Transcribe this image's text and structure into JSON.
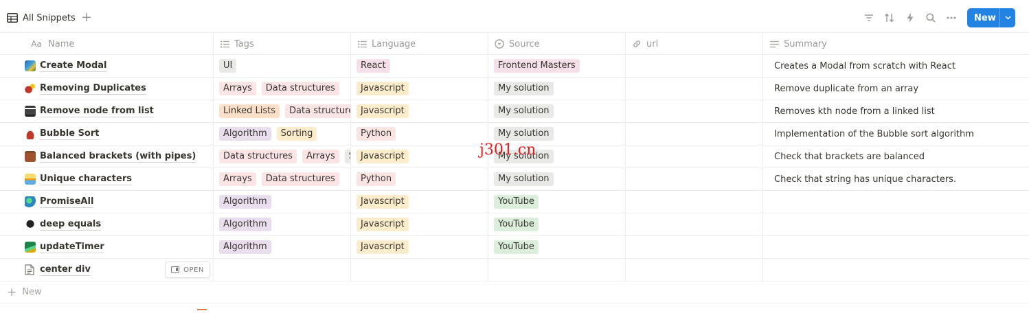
{
  "view": {
    "title": "All Snippets",
    "add_icon": "plus-icon"
  },
  "toolbar": {
    "icons": [
      "filter-icon",
      "sort-icon",
      "lightning-icon",
      "search-icon",
      "more-icon"
    ],
    "new_label": "New"
  },
  "columns": [
    {
      "label": "Name",
      "icon": "title-icon"
    },
    {
      "label": "Tags",
      "icon": "list-icon"
    },
    {
      "label": "Language",
      "icon": "list-icon"
    },
    {
      "label": "Source",
      "icon": "select-icon"
    },
    {
      "label": "url",
      "icon": "link-icon"
    },
    {
      "label": "Summary",
      "icon": "text-icon"
    }
  ],
  "colors": {
    "gray": "#e9e9e7",
    "red": "#fbe4e4",
    "orange": "#fbdfc9",
    "yellow": "#fbeccc",
    "purple": "#e8deee",
    "green": "#dbeddb",
    "pink": "#f5e0e9",
    "accent": "#2383e2"
  },
  "rows": [
    {
      "name": "Create Modal",
      "icon": "painting-icon",
      "tags": [
        {
          "t": "UI",
          "c": "gray"
        }
      ],
      "language": {
        "t": "React",
        "c": "pink"
      },
      "source": {
        "t": "Frontend Masters",
        "c": "pink"
      },
      "url": "",
      "summary": "Creates a Modal from scratch with React"
    },
    {
      "name": "Removing Duplicates",
      "icon": "party-popper-icon",
      "tags": [
        {
          "t": "Arrays",
          "c": "red"
        },
        {
          "t": "Data structures",
          "c": "red"
        }
      ],
      "language": {
        "t": "Javascript",
        "c": "yellow"
      },
      "source": {
        "t": "My solution",
        "c": "gray"
      },
      "url": "",
      "summary": "Remove duplicate from an array"
    },
    {
      "name": "Remove node from list",
      "icon": "bank-icon",
      "tags": [
        {
          "t": "Linked Lists",
          "c": "orange"
        },
        {
          "t": "Data structures",
          "c": "red"
        }
      ],
      "language": {
        "t": "Javascript",
        "c": "yellow"
      },
      "source": {
        "t": "My solution",
        "c": "gray"
      },
      "url": "",
      "summary": "Removes kth node from a linked list"
    },
    {
      "name": "Bubble Sort",
      "icon": "roller-skate-icon",
      "tags": [
        {
          "t": "Algorithm",
          "c": "purple"
        },
        {
          "t": "Sorting",
          "c": "yellow"
        }
      ],
      "language": {
        "t": "Python",
        "c": "red"
      },
      "source": {
        "t": "My solution",
        "c": "gray"
      },
      "url": "",
      "summary": "Implementation of the Bubble sort algorithm"
    },
    {
      "name": "Balanced brackets (with pipes)",
      "icon": "briefcase-icon",
      "tags": [
        {
          "t": "Data structures",
          "c": "red"
        },
        {
          "t": "Arrays",
          "c": "red"
        },
        {
          "t": "St",
          "c": "gray"
        }
      ],
      "language": {
        "t": "Javascript",
        "c": "yellow"
      },
      "source": {
        "t": "My solution",
        "c": "gray"
      },
      "url": "",
      "summary": "Check that brackets are balanced"
    },
    {
      "name": "Unique characters",
      "icon": "sailboat-icon",
      "tags": [
        {
          "t": "Arrays",
          "c": "red"
        },
        {
          "t": "Data structures",
          "c": "red"
        }
      ],
      "language": {
        "t": "Python",
        "c": "red"
      },
      "source": {
        "t": "My solution",
        "c": "gray"
      },
      "url": "",
      "summary": "Check that string has unique characters."
    },
    {
      "name": "PromiseAll",
      "icon": "globe-icon",
      "tags": [
        {
          "t": "Algorithm",
          "c": "purple"
        }
      ],
      "language": {
        "t": "Javascript",
        "c": "yellow"
      },
      "source": {
        "t": "YouTube",
        "c": "green"
      },
      "url": "",
      "summary": ""
    },
    {
      "name": "deep equals",
      "icon": "spade-icon",
      "tags": [
        {
          "t": "Algorithm",
          "c": "purple"
        }
      ],
      "language": {
        "t": "Javascript",
        "c": "yellow"
      },
      "source": {
        "t": "YouTube",
        "c": "green"
      },
      "url": "",
      "summary": ""
    },
    {
      "name": "updateTimer",
      "icon": "park-icon",
      "tags": [
        {
          "t": "Algorithm",
          "c": "purple"
        }
      ],
      "language": {
        "t": "Javascript",
        "c": "yellow"
      },
      "source": {
        "t": "YouTube",
        "c": "green"
      },
      "url": "",
      "summary": ""
    },
    {
      "name": "center div",
      "icon": "page-icon",
      "tags": [],
      "language": null,
      "source": null,
      "url": "",
      "summary": "",
      "open_label": "OPEN"
    }
  ],
  "new_row_label": "New",
  "watermark": "j301.cn"
}
